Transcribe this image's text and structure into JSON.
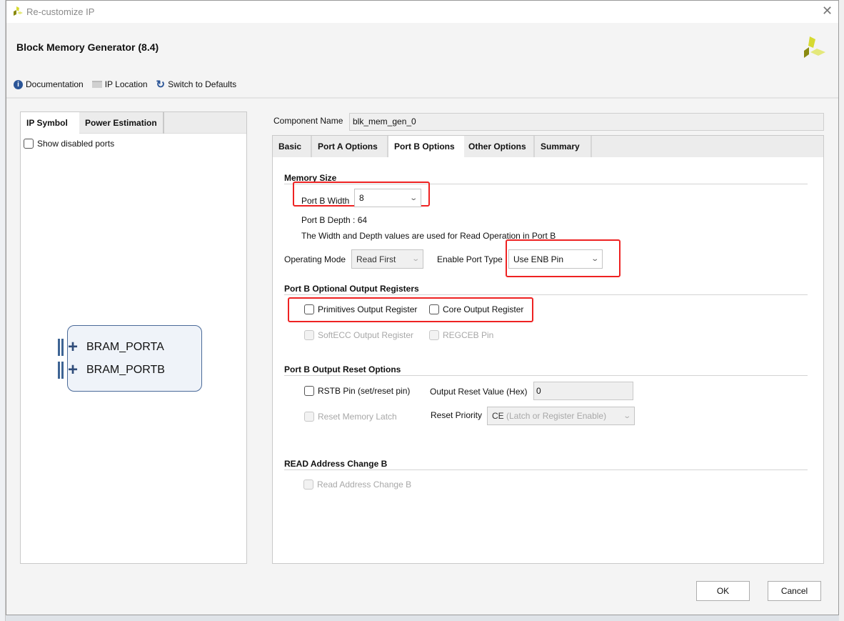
{
  "window": {
    "title": "Re-customize IP"
  },
  "header": {
    "title": "Block Memory Generator (8.4)"
  },
  "toolbar": {
    "documentation": "Documentation",
    "ip_location": "IP Location",
    "switch_defaults": "Switch to Defaults"
  },
  "left_panel": {
    "tabs": [
      "IP Symbol",
      "Power Estimation"
    ],
    "active_tab": "IP Symbol",
    "show_disabled_ports": "Show disabled ports",
    "ports": [
      "BRAM_PORTA",
      "BRAM_PORTB"
    ]
  },
  "component": {
    "label": "Component Name",
    "value": "blk_mem_gen_0"
  },
  "tabs": [
    "Basic",
    "Port A Options",
    "Port B Options",
    "Other Options",
    "Summary"
  ],
  "active_tab": "Port B Options",
  "memory_size": {
    "title": "Memory Size",
    "width_label": "Port B Width",
    "width_value": "8",
    "depth": "Port B Depth : 64",
    "note": "The Width and Depth values are used for Read Operation in Port B",
    "op_mode_label": "Operating Mode",
    "op_mode_value": "Read First",
    "enable_label": "Enable Port Type",
    "enable_value": "Use ENB Pin"
  },
  "output_registers": {
    "title": "Port B Optional Output Registers",
    "primitives": "Primitives Output Register",
    "core": "Core Output Register",
    "softecc": "SoftECC Output Register",
    "regceb": "REGCEB Pin"
  },
  "reset": {
    "title": "Port B Output Reset Options",
    "rstb": "RSTB Pin (set/reset pin)",
    "reset_value_label": "Output Reset Value (Hex)",
    "reset_value": "0",
    "reset_latch": "Reset Memory Latch",
    "priority_label": "Reset Priority",
    "priority_value_main": "CE",
    "priority_value_rest": "(Latch or Register Enable)"
  },
  "read_addr": {
    "title": "READ Address Change B",
    "option": "Read Address Change B"
  },
  "buttons": {
    "ok": "OK",
    "cancel": "Cancel"
  },
  "colors": {
    "highlight": "#ee2222",
    "logo": "#c8cc2a",
    "symbol_border": "#4a6a99"
  }
}
